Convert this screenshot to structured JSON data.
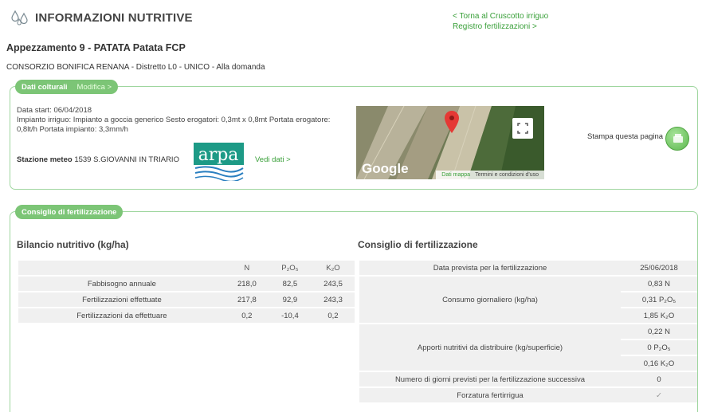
{
  "header": {
    "title": "INFORMAZIONI NUTRITIVE",
    "icon": "water-drops-icon"
  },
  "links": {
    "back": "< Torna al Cruscotto irriguo",
    "registry": "Registro fertilizzazioni >"
  },
  "plot": {
    "title": "Appezzamento 9 - PATATA Patata FCP",
    "consorzio": "CONSORZIO BONIFICA RENANA - Distretto L0 - UNICO - Alla domanda"
  },
  "crop_panel": {
    "tab": "Dati colturali",
    "edit": "Modifica >",
    "start": "Data start: 06/04/2018",
    "irrigation": "Impianto irriguo: Impianto a goccia generico Sesto erogatori: 0,3mt x 0,8mt Portata erogatore: 0,8lt/h Portata impianto: 3,3mm/h",
    "meteo_label": "Stazione meteo",
    "meteo_value": "1539 S.GIOVANNI IN TRIARIO",
    "logo": "arpa",
    "see_data": "Vedi dati >",
    "map": {
      "brand": "Google",
      "data_link": "Dati mappa",
      "terms": "Termini e condizioni d'uso"
    },
    "print": "Stampa questa pagina"
  },
  "fert_panel": {
    "tab": "Consiglio di fertilizzazione",
    "balance_title": "Bilancio nutritivo (kg/ha)",
    "advice_title": "Consiglio di fertilizzazione",
    "balance_headers": [
      "N",
      "P₂O₅",
      "K₂O"
    ],
    "balance_rows": [
      {
        "label": "Fabbisogno annuale",
        "n": "218,0",
        "p": "82,5",
        "k": "243,5"
      },
      {
        "label": "Fertilizzazioni effettuate",
        "n": "217,8",
        "p": "92,9",
        "k": "243,3"
      },
      {
        "label": "Fertilizzazioni da effettuare",
        "n": "0,2",
        "p": "-10,4",
        "k": "0,2"
      }
    ],
    "advice": {
      "date_label": "Data prevista per la fertilizzazione",
      "date_value": "25/06/2018",
      "daily_label": "Consumo giornaliero (kg/ha)",
      "daily_values": [
        "0,83 N",
        "0,31 P₂O₅",
        "1,85 K₂O"
      ],
      "supply_label": "Apporti nutritivi da distribuire (kg/superficie)",
      "supply_values": [
        "0,22 N",
        "0 P₂O₅",
        "0,16 K₂O"
      ],
      "days_label": "Numero di giorni previsti per la fertilizzazione successiva",
      "days_value": "0",
      "forced_label": "Forzatura fertirrigua",
      "forced_value": "✓"
    }
  },
  "colors": {
    "accent": "#7cc576",
    "link": "#3aa03a",
    "border": "#9fd69f"
  }
}
